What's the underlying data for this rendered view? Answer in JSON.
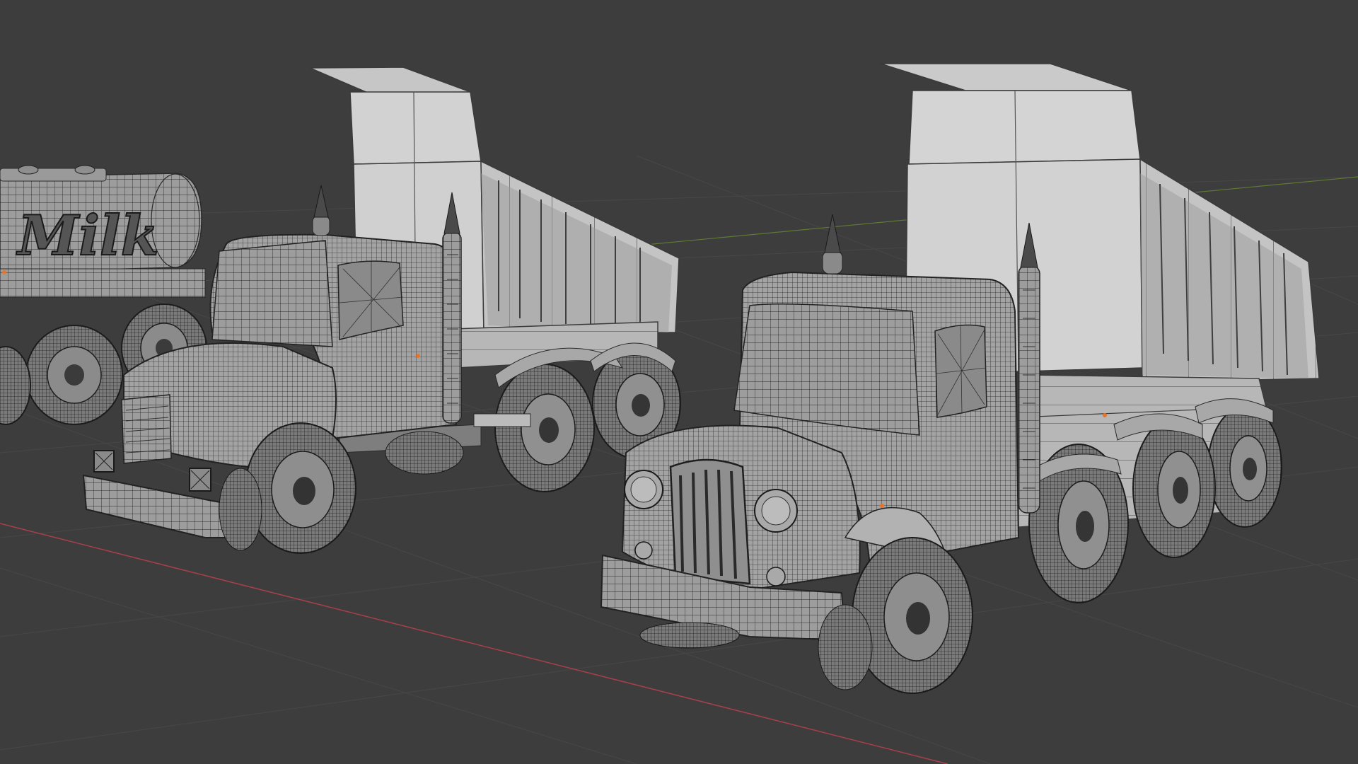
{
  "viewport": {
    "background": "#3d3d3d",
    "grid_color": "#4a4a4a",
    "x_axis_color": "#b04a55",
    "y_axis_color": "#6f8a3e",
    "mesh_fill": "#9c9c9c",
    "mesh_light": "#bdbdbd",
    "mesh_dark": "#6e6e6e",
    "wire_color": "#2a2a2a",
    "origin_color": "#e8742a"
  },
  "objects": {
    "tanker_label": "Milk",
    "dump_truck_left": "dump-truck",
    "dump_truck_right": "dump-truck"
  }
}
